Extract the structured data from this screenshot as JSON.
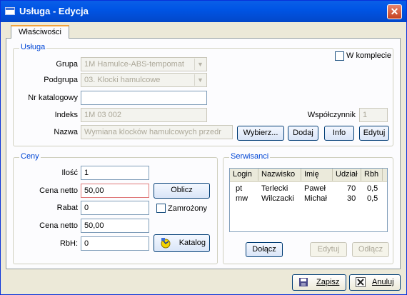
{
  "window": {
    "title": "Usługa - Edycja",
    "close_glyph": "✕"
  },
  "tabs": [
    {
      "label": "Właściwości",
      "active": true
    }
  ],
  "usluga": {
    "group_label": "Usługa",
    "grupa_label": "Grupa",
    "grupa_value": "1M Hamulce-ABS-tempomat",
    "podgrupa_label": "Podgrupa",
    "podgrupa_value": "03. Klocki hamulcowe",
    "nr_katalogowy_label": "Nr katalogowy",
    "nr_katalogowy_value": "",
    "indeks_label": "Indeks",
    "indeks_value": "1M 03 002",
    "wspolczynnik_label": "Współczynnik",
    "wspolczynnik_value": "1",
    "nazwa_label": "Nazwa",
    "nazwa_value": "Wymiana klocków hamulcowych przedr",
    "w_komplecie_label": "W komplecie",
    "w_komplecie_checked": false,
    "buttons": {
      "wybierz": "Wybierz...",
      "dodaj": "Dodaj",
      "info": "Info",
      "edytuj": "Edytuj"
    }
  },
  "ceny": {
    "group_label": "Ceny",
    "ilosc_label": "Ilość",
    "ilosc_value": "1",
    "cena_netto_label": "Cena netto",
    "cena_netto_value": "50,00",
    "oblicz_label": "Oblicz",
    "rabat_label": "Rabat",
    "rabat_value": "0",
    "zamrozony_label": "Zamrożony",
    "zamrozony_checked": false,
    "cena_netto2_label": "Cena netto",
    "cena_netto2_value": "50,00",
    "rbh_label": "RbH:",
    "rbh_value": "0",
    "katalog_label": "Katalog",
    "katalog_icon": "catalog-icon"
  },
  "serwisanci": {
    "group_label": "Serwisanci",
    "columns": [
      "Login",
      "Nazwisko",
      "Imię",
      "Udział",
      "Rbh"
    ],
    "rows": [
      {
        "login": "pt",
        "nazwisko": "Terlecki",
        "imie": "Paweł",
        "udzial": "70",
        "rbh": "0,5"
      },
      {
        "login": "mw",
        "nazwisko": "Wilczacki",
        "imie": "Michał",
        "udzial": "30",
        "rbh": "0,5"
      }
    ],
    "buttons": {
      "dolacz": "Dołącz",
      "edytuj": "Edytuj",
      "odlacz": "Odłącz"
    }
  },
  "footer": {
    "zapisz_label": "Zapisz",
    "zapisz_icon": "save-icon",
    "anuluj_label": "Anuluj",
    "anuluj_icon": "cancel-icon"
  },
  "colors": {
    "accent": "#0046d5",
    "titlebar": "#0055e5",
    "close": "#c5411f",
    "invalid_border": "#e07a7a"
  }
}
